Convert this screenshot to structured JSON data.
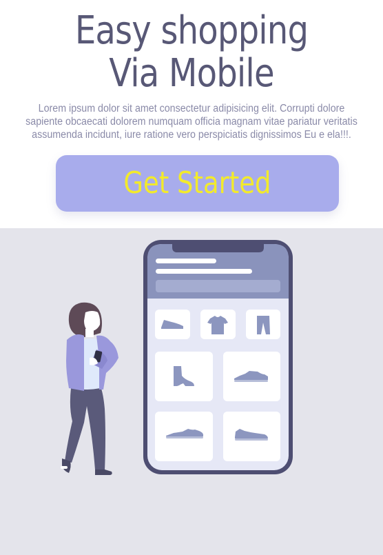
{
  "hero": {
    "title_line1": "Easy shopping",
    "title_line2": "Via Mobile",
    "description": "Lorem ipsum dolor sit amet consectetur adipisicing elit. Corrupti dolore sapiente obcaecati dolorem numquam officia magnam vitae pariatur veritatis assumenda incidunt, iure ratione vero perspiciatis dignissimos Eu e ela!!!."
  },
  "cta": {
    "label": "Get Started"
  },
  "colors": {
    "title": "#585876",
    "description": "#8a8aa8",
    "button_bg": "#a8acec",
    "button_text": "#f2ea2c",
    "panel_bg": "#e4e4eb",
    "phone_frame": "#4e4e72",
    "phone_header": "#8a93bc",
    "phone_screen": "#e6e8f6",
    "product_icon": "#8c96bf"
  },
  "illustration": {
    "description_icons": [
      "shoe-icon",
      "tshirt-icon",
      "pants-icon",
      "boot-icon",
      "sneaker-icon",
      "sneaker-icon",
      "sneaker-icon"
    ]
  }
}
